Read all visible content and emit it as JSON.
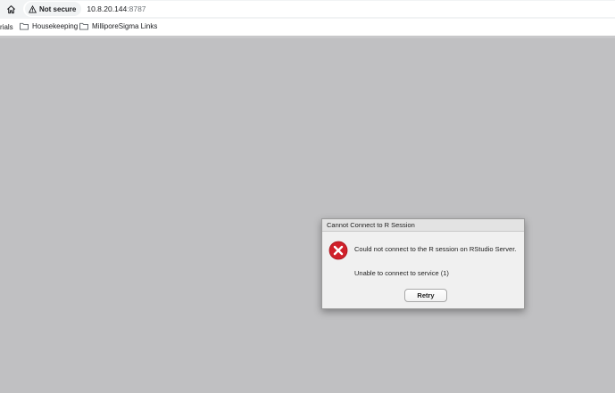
{
  "browser": {
    "security_label": "Not secure",
    "url_host": "10.8.20.144",
    "url_port": ":8787",
    "icons": {
      "home": "home-icon",
      "warning": "warning-triangle-icon",
      "folder": "folder-icon"
    }
  },
  "bookmarks": {
    "cut_label": "rials",
    "items": [
      {
        "label": "Housekeeping"
      },
      {
        "label": "MilliporeSigma Links"
      }
    ]
  },
  "dialog": {
    "title": "Cannot Connect to R Session",
    "message": "Could not connect to the R session on RStudio Server.",
    "detail": "Unable to connect to service (1)",
    "retry_label": "Retry",
    "icon": "error-x-icon",
    "error_color": "#d0202a"
  }
}
